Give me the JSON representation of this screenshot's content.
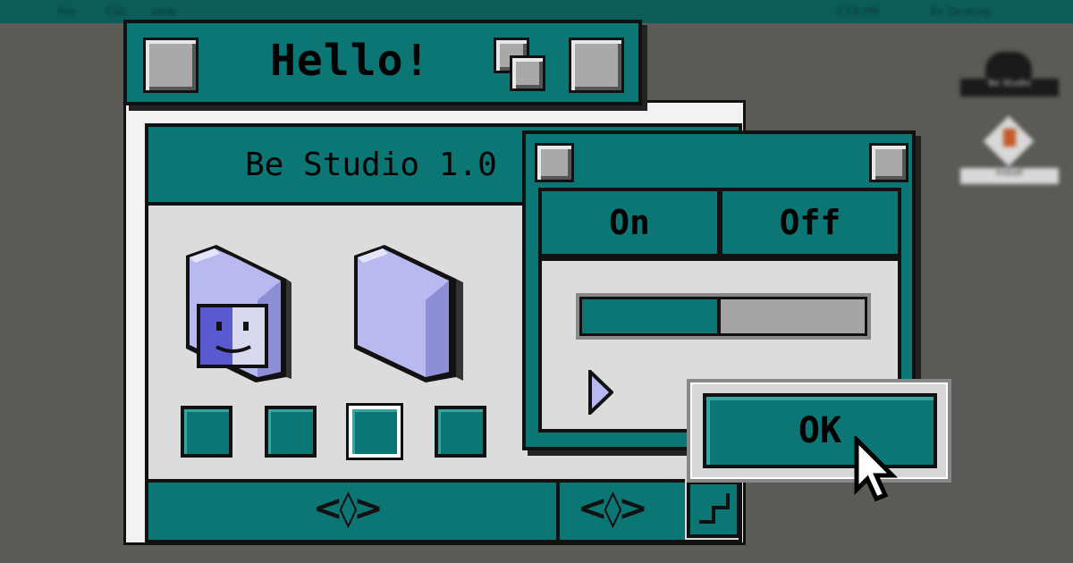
{
  "desktop": {
    "menu_items": [
      "File",
      "Edit",
      "View"
    ],
    "menu_right": [
      "2:19 PM",
      "Be Desktop"
    ],
    "icon_labels": [
      "Be Studio",
      "Install"
    ]
  },
  "hello_window": {
    "title": "Hello!"
  },
  "studio_window": {
    "title": "Be Studio 1.0",
    "folders": [
      "finder-folder-icon",
      "folder-icon"
    ],
    "checkbox_count": 4,
    "footer_arrows": [
      "<◊>",
      "<◊>"
    ]
  },
  "toggle_window": {
    "on_label": "On",
    "off_label": "Off",
    "progress": 0.5
  },
  "dialog": {
    "ok_label": "OK"
  },
  "colors": {
    "teal": "#0b7674",
    "desktop": "#5b5a56",
    "folder": "#b9b9f2"
  }
}
